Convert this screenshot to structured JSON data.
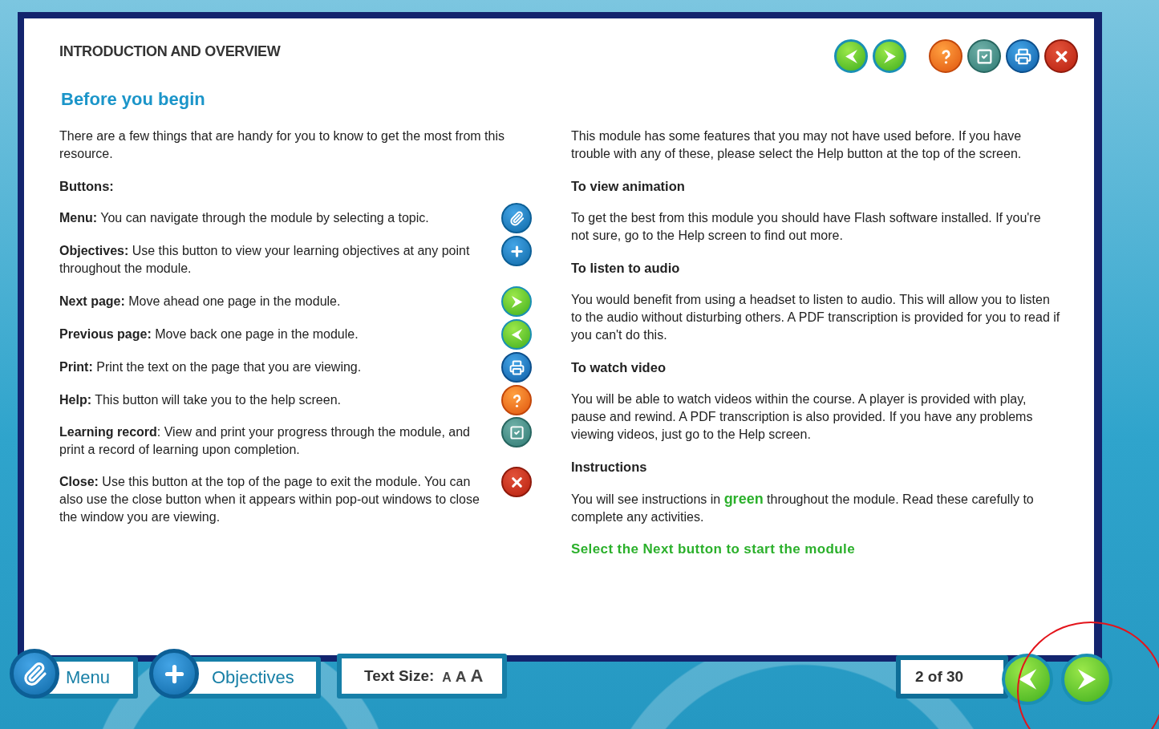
{
  "header": {
    "title": "INTRODUCTION AND OVERVIEW",
    "nav_buttons": [
      {
        "kind": "prev"
      },
      {
        "kind": "next"
      }
    ],
    "tool_buttons": [
      {
        "kind": "help"
      },
      {
        "kind": "record"
      },
      {
        "kind": "print"
      },
      {
        "kind": "close"
      }
    ]
  },
  "heading": "Before you begin",
  "intro": "There are a few things that are handy for you to know to get the most from this resource.",
  "buttons_heading": "Buttons:",
  "button_guide": [
    {
      "text": "**Menu:** You can navigate through the module by selecting a topic.",
      "kind": "menu"
    },
    {
      "text": "**Objectives:** Use this button to view your learning objectives at any point throughout the module.",
      "kind": "objectives"
    },
    {
      "text": "**Next page:** Move ahead one page in the module.",
      "kind": "next"
    },
    {
      "text": "**Previous page:** Move back one page in the module.",
      "kind": "prev"
    },
    {
      "text": "**Print:** Print the text on the page that you are viewing.",
      "kind": "print"
    },
    {
      "text": "**Help:** This button will take you to the help screen.",
      "kind": "help"
    },
    {
      "text": "**Learning record**: View and print your progress through the module, and print a record of learning upon completion.",
      "kind": "record"
    },
    {
      "text": "**Close:** Use this button at the top of the page to exit the module. You can also use the close button when it appears within pop-out windows to close the window you are viewing.",
      "kind": "close"
    }
  ],
  "right_column": [
    {
      "kind": "paragraph",
      "segments": [
        {
          "kind": "plain",
          "text": "This module has some features that you may not have used before. If you have trouble with any of these, please select the Help button at the top of the screen."
        }
      ]
    },
    {
      "kind": "subheading",
      "segments": [
        {
          "kind": "plain",
          "text": "To view animation"
        }
      ]
    },
    {
      "kind": "paragraph",
      "segments": [
        {
          "kind": "plain",
          "text": "To get the best from this module you should have Flash software installed. If you're not sure, go to the Help screen to find out more."
        }
      ]
    },
    {
      "kind": "subheading",
      "segments": [
        {
          "kind": "plain",
          "text": "To listen to audio"
        }
      ]
    },
    {
      "kind": "paragraph",
      "segments": [
        {
          "kind": "plain",
          "text": "You would benefit from using a headset to listen to audio. This will allow you to listen to the audio without disturbing others. A PDF transcription is provided for you to read if you can't do this."
        }
      ]
    },
    {
      "kind": "subheading",
      "segments": [
        {
          "kind": "plain",
          "text": "To watch video"
        }
      ]
    },
    {
      "kind": "paragraph",
      "segments": [
        {
          "kind": "plain",
          "text": "You will be able to watch videos within the course. A player is provided with play, pause and rewind. A PDF transcription is also provided. If you have any problems viewing videos, just go to the Help screen."
        }
      ]
    },
    {
      "kind": "subheading",
      "segments": [
        {
          "kind": "plain",
          "text": "Instructions"
        }
      ]
    },
    {
      "kind": "paragraph",
      "segments": [
        {
          "kind": "plain",
          "text": "You will see instructions in "
        },
        {
          "kind": "green",
          "text": "green"
        },
        {
          "kind": "plain",
          "text": " throughout the module. Read these carefully to complete any activities."
        }
      ]
    },
    {
      "kind": "instruction",
      "segments": [
        {
          "kind": "plain",
          "text": "Select the Next button to start the module"
        }
      ]
    }
  ],
  "bottom_bar": {
    "tabs": [
      {
        "label": "Menu",
        "kind": "menu"
      },
      {
        "label": "Objectives",
        "kind": "objectives"
      }
    ],
    "text_size": {
      "label": "Text Size:",
      "sizes": [
        "A",
        "A",
        "A"
      ]
    },
    "page_counter": "2 of 30",
    "highlight_ring": true
  }
}
